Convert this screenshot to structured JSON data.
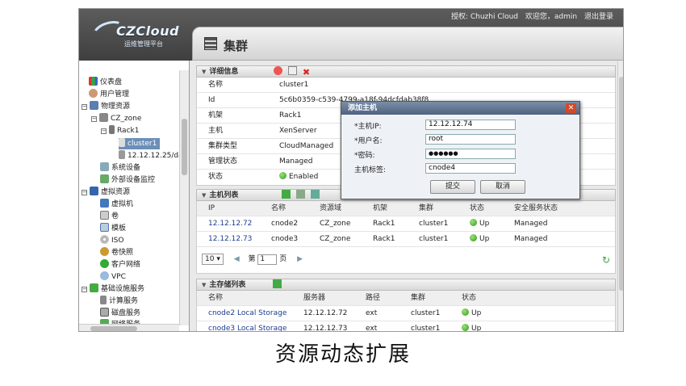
{
  "header": {
    "brand": "CZCloud",
    "brand_sub": "运维管理平台",
    "authorized": "授权: Chuzhi Cloud",
    "welcome": "欢迎您，admin",
    "logout": "退出登录"
  },
  "page_title": "集群",
  "sidebar": {
    "items": [
      {
        "label": "仪表盘",
        "icon": "dashboard-icon"
      },
      {
        "label": "用户管理",
        "icon": "user-icon"
      },
      {
        "label": "物理资源",
        "icon": "server-icon"
      },
      {
        "label": "CZ_zone",
        "icon": "zone-icon"
      },
      {
        "label": "Rack1",
        "icon": "rack-icon"
      },
      {
        "label": "cluster1",
        "icon": "cluster-icon"
      },
      {
        "label": "12.12.12.25/da",
        "icon": "host-icon"
      },
      {
        "label": "系统设备",
        "icon": "system-device-icon"
      },
      {
        "label": "外部设备监控",
        "icon": "monitor-icon"
      },
      {
        "label": "虚拟资源",
        "icon": "virtual-icon"
      },
      {
        "label": "虚拟机",
        "icon": "vm-icon"
      },
      {
        "label": "卷",
        "icon": "volume-icon"
      },
      {
        "label": "模板",
        "icon": "template-icon"
      },
      {
        "label": "ISO",
        "icon": "iso-icon"
      },
      {
        "label": "卷快照",
        "icon": "snapshot-icon"
      },
      {
        "label": "客户网络",
        "icon": "network-icon"
      },
      {
        "label": "VPC",
        "icon": "vpc-icon"
      },
      {
        "label": "基础设施服务",
        "icon": "infra-icon"
      },
      {
        "label": "计算服务",
        "icon": "compute-icon"
      },
      {
        "label": "磁盘服务",
        "icon": "disk-icon"
      },
      {
        "label": "网络服务",
        "icon": "net-service-icon"
      }
    ]
  },
  "details": {
    "title": "详细信息",
    "rows": [
      {
        "k": "名称",
        "v": "cluster1"
      },
      {
        "k": "Id",
        "v": "5c6b0359-c539-4799-a18f-94dcfdab38f8"
      },
      {
        "k": "机架",
        "v": "Rack1"
      },
      {
        "k": "主机",
        "v": "XenServer"
      },
      {
        "k": "集群类型",
        "v": "CloudManaged"
      },
      {
        "k": "管理状态",
        "v": "Managed"
      },
      {
        "k": "状态",
        "v": "Enabled"
      }
    ]
  },
  "hosts": {
    "title": "主机列表",
    "columns": [
      "IP",
      "名称",
      "资源域",
      "机架",
      "集群",
      "状态",
      "安全服务状态"
    ],
    "rows": [
      [
        "12.12.12.72",
        "cnode2",
        "CZ_zone",
        "Rack1",
        "cluster1",
        "Up",
        "Managed"
      ],
      [
        "12.12.12.73",
        "cnode3",
        "CZ_zone",
        "Rack1",
        "cluster1",
        "Up",
        "Managed"
      ]
    ],
    "pager": {
      "page_size": "10",
      "page_prefix": "第",
      "page": "1",
      "page_suffix": "页"
    }
  },
  "storage": {
    "title": "主存储列表",
    "columns": [
      "名称",
      "服务器",
      "路径",
      "集群",
      "状态"
    ],
    "rows": [
      [
        "cnode2 Local Storage",
        "12.12.12.72",
        "ext",
        "cluster1",
        "Up"
      ],
      [
        "cnode3 Local Storage",
        "12.12.12.73",
        "ext",
        "cluster1",
        "Up"
      ]
    ]
  },
  "dialog": {
    "title": "添加主机",
    "ip_label": "*主机IP:",
    "ip_value": "12.12.12.74",
    "user_label": "*用户名:",
    "user_value": "root",
    "pwd_label": "*密码:",
    "pwd_value": "●●●●●●",
    "tag_label": "主机标签:",
    "tag_value": "cnode4",
    "submit": "提交",
    "cancel": "取消"
  },
  "caption": "资源动态扩展",
  "colors": {
    "selected": "#6b8fb8",
    "link": "#1b3c8f",
    "status_up": "#2f9a1a"
  }
}
